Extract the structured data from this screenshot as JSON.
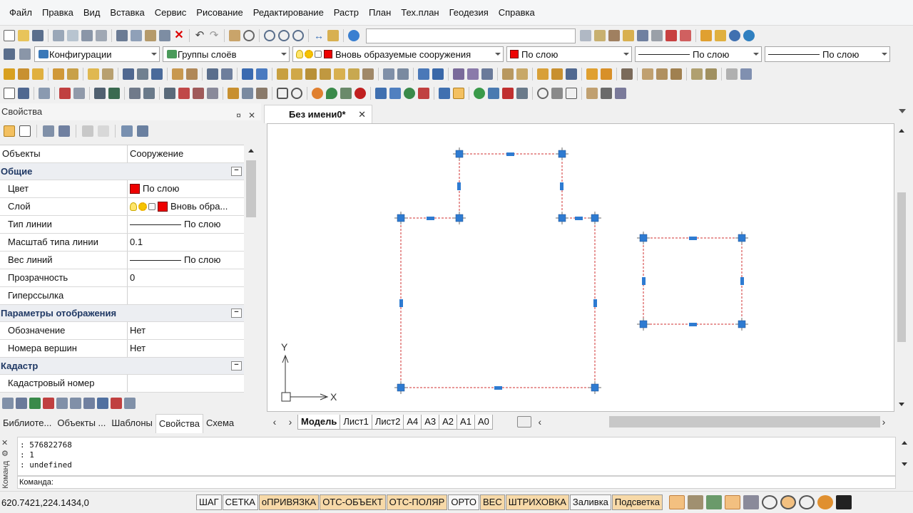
{
  "menu": [
    "Файл",
    "Правка",
    "Вид",
    "Вставка",
    "Сервис",
    "Рисование",
    "Редактирование",
    "Растр",
    "План",
    "Тех.план",
    "Геодезия",
    "Справка"
  ],
  "layerbar": {
    "config_label": "Конфигурации",
    "layer_groups_label": "Группы слоёв",
    "current_layer": "Вновь образуемые сооружения",
    "color_value": "По слою",
    "linetype_value": "По слою",
    "lineweight_value": "По слою"
  },
  "properties": {
    "title": "Свойства",
    "pin_icon": "pin-icon",
    "close_glyph": "✕",
    "object_key": "Объекты",
    "object_value": "Сооружение",
    "sections": {
      "general": "Общие",
      "display": "Параметры отображения",
      "cadastre": "Кадастр"
    },
    "rows": {
      "color": {
        "k": "Цвет",
        "v": "По слою"
      },
      "layer": {
        "k": "Слой",
        "v": "Вновь обра..."
      },
      "linetype": {
        "k": "Тип линии",
        "v": "По слою"
      },
      "ltscale": {
        "k": "Масштаб типа линии",
        "v": "0.1"
      },
      "lineweight": {
        "k": "Вес линий",
        "v": "По слою"
      },
      "transparency": {
        "k": "Прозрачность",
        "v": "0"
      },
      "hyperlink": {
        "k": "Гиперссылка",
        "v": ""
      },
      "designation": {
        "k": "Обозначение",
        "v": "Нет"
      },
      "vertex_numbers": {
        "k": "Номера вершин",
        "v": "Нет"
      },
      "cadastral_number": {
        "k": "Кадастровый номер",
        "v": ""
      }
    },
    "collapse_glyph": "−"
  },
  "panel_tabs": [
    "Библиоте...",
    "Объекты ...",
    "Шаблоны",
    "Свойства",
    "Схема"
  ],
  "document": {
    "tab_title": "Без имени0*",
    "close_glyph": "✕"
  },
  "ucs": {
    "x": "X",
    "y": "Y"
  },
  "layout_tabs": [
    "Модель",
    "Лист1",
    "Лист2",
    "А4",
    "А3",
    "А2",
    "А1",
    "А0"
  ],
  "command": {
    "side_label": "Команд",
    "history": [
      ": 576822768",
      ": 1",
      ": undefined"
    ],
    "prompt": "Команда:"
  },
  "status": {
    "coords": "620.7421,224.1434,0",
    "buttons": [
      {
        "label": "ШАГ",
        "on": false
      },
      {
        "label": "СЕТКА",
        "on": false
      },
      {
        "label": "оПРИВЯЗКА",
        "on": true
      },
      {
        "label": "ОТС-ОБЪЕКТ",
        "on": true
      },
      {
        "label": "ОТС-ПОЛЯР",
        "on": true
      },
      {
        "label": "ОРТО",
        "on": false
      },
      {
        "label": "ВЕС",
        "on": true
      },
      {
        "label": "ШТРИХОВКА",
        "on": true
      },
      {
        "label": "Заливка",
        "on": false
      },
      {
        "label": "Подсветка",
        "on": true
      }
    ]
  },
  "colors": {
    "grip": "#2e7bd1",
    "entity_line": "#d03030",
    "bylayer": "#ee0000"
  }
}
